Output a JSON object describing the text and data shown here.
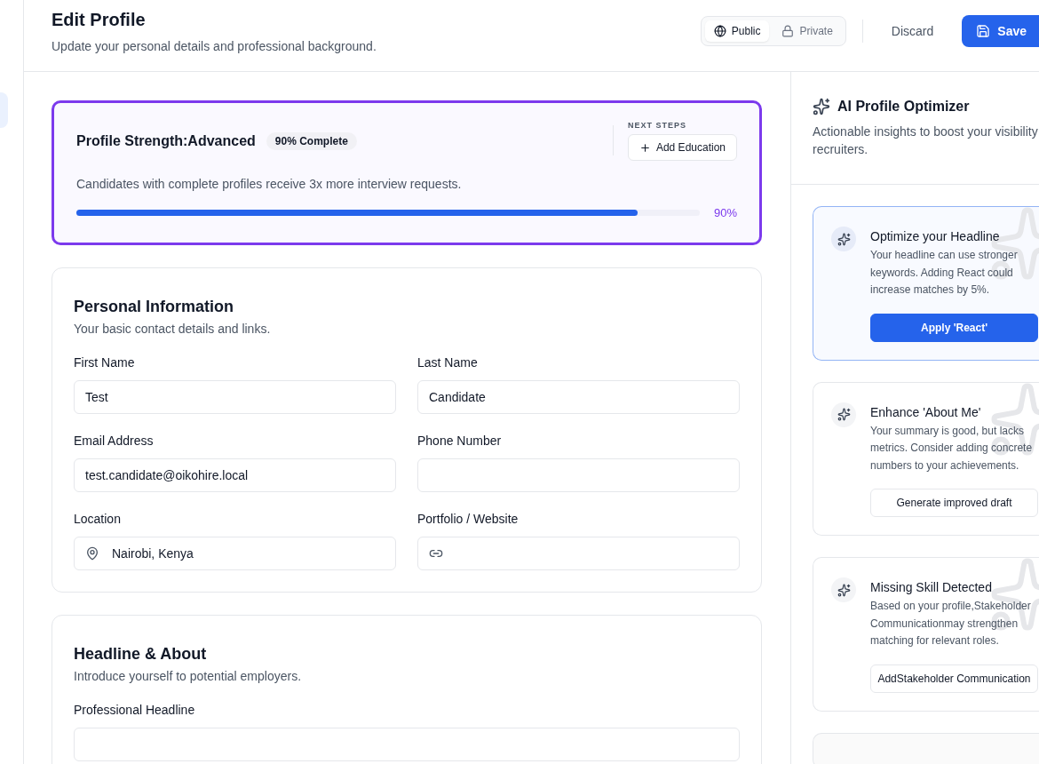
{
  "header": {
    "title": "Edit Profile",
    "subtitle": "Update your personal details and professional background.",
    "visibility": [
      {
        "label": "Public",
        "selected": true
      },
      {
        "label": "Private",
        "selected": false
      }
    ],
    "discard": "Discard",
    "save": "Save"
  },
  "strength": {
    "title": "Profile Strength:Advanced",
    "badge": "90% Complete",
    "next_steps_label": "NEXT STEPS",
    "next_step_button": "Add Education",
    "message": "Candidates with complete profiles receive 3x more interview requests.",
    "level": 0.9,
    "reading": "90%"
  },
  "sections": [
    {
      "title": "Personal Information",
      "subtitle": "Your basic contact details and links.",
      "fields": [
        {
          "label": "First Name",
          "kind": "text",
          "value": "Test"
        },
        {
          "label": "Last Name",
          "kind": "text",
          "value": "Candidate"
        },
        {
          "label": "Email Address",
          "kind": "text",
          "value": "test.candidate@oikohire.local"
        },
        {
          "label": "Phone Number",
          "kind": "text"
        },
        {
          "label": "Location",
          "kind": "location",
          "value": "Nairobi, Kenya"
        },
        {
          "label": "Portfolio / Website",
          "kind": "link"
        }
      ]
    },
    {
      "title": "Headline & About",
      "subtitle": "Introduce yourself to potential employers.",
      "fields": [
        {
          "label": "Professional Headline",
          "kind": "wide"
        }
      ]
    }
  ],
  "optimizer": {
    "title": "AI Profile Optimizer",
    "subtitle": "Actionable insights to boost your visibility recruiters.",
    "suggestions": [
      {
        "kind": "primary",
        "title": "Optimize your Headline",
        "text": "Your headline can use stronger keywords. Adding React could increase matches by 5%.",
        "action": "Apply 'React'"
      },
      {
        "kind": "secondary",
        "title": "Enhance 'About Me'",
        "text": "Your summary is good, but lacks metrics. Consider adding concrete numbers to your achievements.",
        "action": "Generate improved draft"
      },
      {
        "kind": "secondary",
        "title": "Missing Skill Detected",
        "text": "Based on your profile,Stakeholder Communicationmay strengthen matching for relevant roles.",
        "action": "AddStakeholder Communication"
      }
    ]
  }
}
